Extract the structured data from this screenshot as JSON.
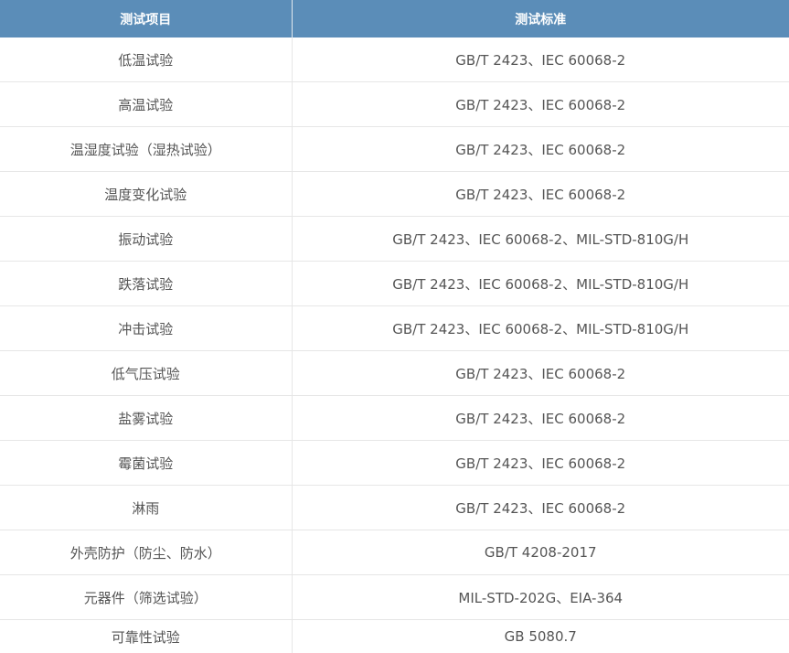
{
  "table": {
    "headers": [
      "测试项目",
      "测试标准"
    ],
    "rows": [
      [
        "低温试验",
        "GB/T 2423、IEC 60068-2"
      ],
      [
        "高温试验",
        "GB/T 2423、IEC 60068-2"
      ],
      [
        "温湿度试验（湿热试验）",
        "GB/T 2423、IEC 60068-2"
      ],
      [
        "温度变化试验",
        "GB/T 2423、IEC 60068-2"
      ],
      [
        "振动试验",
        "GB/T 2423、IEC 60068-2、MIL-STD-810G/H"
      ],
      [
        "跌落试验",
        "GB/T 2423、IEC 60068-2、MIL-STD-810G/H"
      ],
      [
        "冲击试验",
        "GB/T 2423、IEC 60068-2、MIL-STD-810G/H"
      ],
      [
        "低气压试验",
        "GB/T 2423、IEC 60068-2"
      ],
      [
        "盐雾试验",
        "GB/T 2423、IEC 60068-2"
      ],
      [
        "霉菌试验",
        "GB/T 2423、IEC 60068-2"
      ],
      [
        "淋雨",
        "GB/T 2423、IEC 60068-2"
      ],
      [
        "外壳防护（防尘、防水）",
        "GB/T 4208-2017"
      ],
      [
        "元器件（筛选试验）",
        "MIL-STD-202G、EIA-364"
      ],
      [
        "可靠性试验",
        "GB 5080.7"
      ]
    ]
  },
  "colors": {
    "header_bg": "#5b8db8",
    "header_text": "#ffffff",
    "cell_text": "#555555",
    "border": "#e6e6e6"
  }
}
